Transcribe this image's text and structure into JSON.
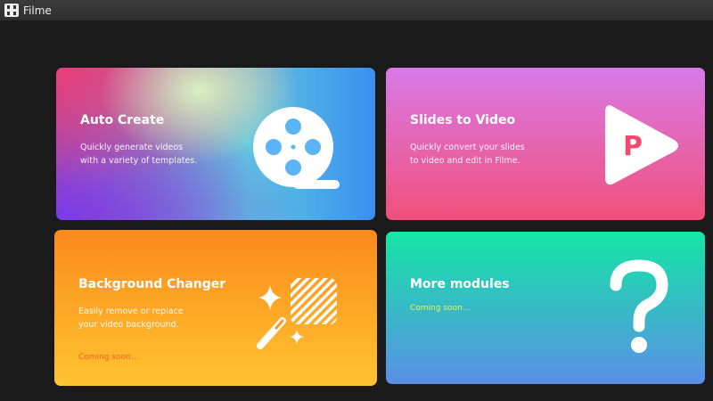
{
  "app": {
    "title": "Filme"
  },
  "cards": [
    {
      "title": "Auto Create",
      "desc": [
        "Quickly generate videos",
        "with a variety of templates."
      ],
      "icon": "film-reel-icon"
    },
    {
      "title": "Slides to Video",
      "desc": [
        "Quickly convert your slides",
        "to video and edit in Filme."
      ],
      "icon": "play-slides-icon"
    },
    {
      "title": "Background Changer",
      "desc": [
        "Easily remove or replace",
        "your video background."
      ],
      "status": "Coming soon...",
      "status_color": "#f5621c",
      "icon": "magic-wand-icon"
    },
    {
      "title": "More modules",
      "status": "Coming soon...",
      "status_color": "#f0f050",
      "icon": "question-mark-icon"
    }
  ]
}
